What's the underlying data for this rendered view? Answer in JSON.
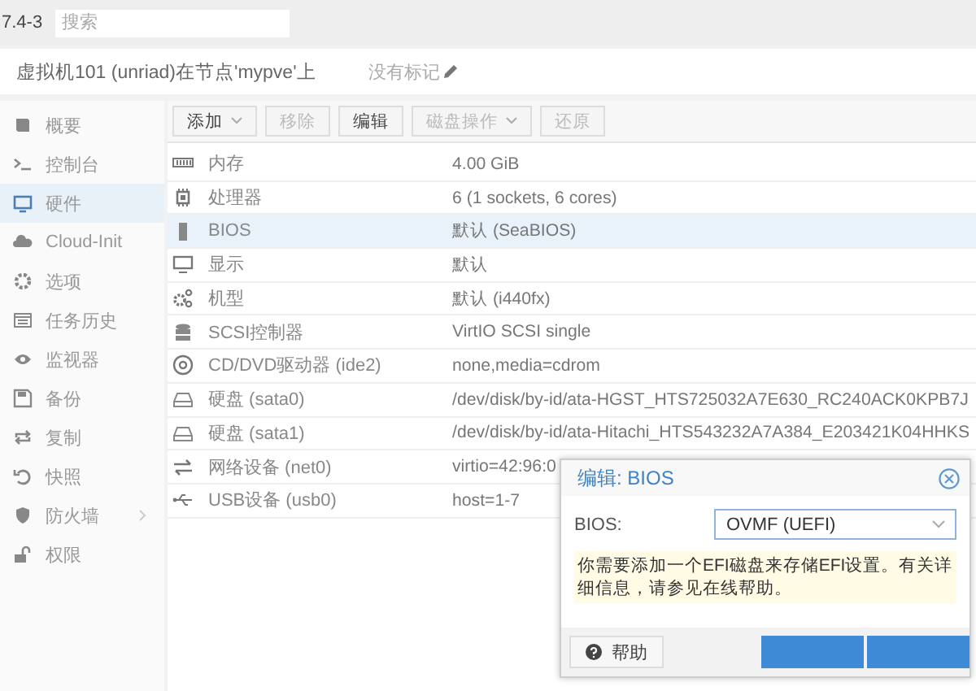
{
  "top_bar": {
    "version": "7.4-3",
    "search": {
      "placeholder": "搜索"
    }
  },
  "header": {
    "title": "虚拟机101 (unriad)在节点'mypve'上",
    "tags": "没有标记"
  },
  "sidebar": {
    "items": [
      {
        "label": "概要",
        "selected": false
      },
      {
        "label": "控制台",
        "selected": false
      },
      {
        "label": "硬件",
        "selected": true
      },
      {
        "label": "Cloud-Init",
        "selected": false
      },
      {
        "label": "选项",
        "selected": false
      },
      {
        "label": "任务历史",
        "selected": false
      },
      {
        "label": "监视器",
        "selected": false
      },
      {
        "label": "备份",
        "selected": false
      },
      {
        "label": "复制",
        "selected": false
      },
      {
        "label": "快照",
        "selected": false
      },
      {
        "label": "防火墙",
        "selected": false,
        "expandable": true
      },
      {
        "label": "权限",
        "selected": false
      }
    ]
  },
  "toolbar": [
    {
      "label": "添加",
      "menu": true,
      "disabled": false
    },
    {
      "label": "移除",
      "menu": false,
      "disabled": true
    },
    {
      "label": "编辑",
      "menu": false,
      "disabled": false
    },
    {
      "label": "磁盘操作",
      "menu": true,
      "disabled": true
    },
    {
      "label": "还原",
      "menu": false,
      "disabled": true
    }
  ],
  "hardware": [
    {
      "name": "内存",
      "value": "4.00 GiB",
      "selected": false
    },
    {
      "name": "处理器",
      "value": "6 (1 sockets, 6 cores)",
      "selected": false
    },
    {
      "name": "BIOS",
      "value": "默认 (SeaBIOS)",
      "selected": true
    },
    {
      "name": "显示",
      "value": "默认",
      "selected": false
    },
    {
      "name": "机型",
      "value": "默认 (i440fx)",
      "selected": false
    },
    {
      "name": "SCSI控制器",
      "value": "VirtIO SCSI single",
      "selected": false
    },
    {
      "name": "CD/DVD驱动器 (ide2)",
      "value": "none,media=cdrom",
      "selected": false
    },
    {
      "name": "硬盘 (sata0)",
      "value": "/dev/disk/by-id/ata-HGST_HTS725032A7E630_RC240ACK0KPB7J",
      "selected": false
    },
    {
      "name": "硬盘 (sata1)",
      "value": "/dev/disk/by-id/ata-Hitachi_HTS543232A7A384_E203421K04HHKS",
      "selected": false
    },
    {
      "name": "网络设备 (net0)",
      "value": "virtio=42:96:0",
      "selected": false
    },
    {
      "name": "USB设备 (usb0)",
      "value": "host=1-7",
      "selected": false
    }
  ],
  "dialog": {
    "title": "编辑: BIOS",
    "field_label": "BIOS:",
    "field_value": "OVMF (UEFI)",
    "note": "你需要添加一个EFI磁盘来存储EFI设置。有关详细信息，请参见在线帮助。",
    "help_button": "帮助"
  }
}
